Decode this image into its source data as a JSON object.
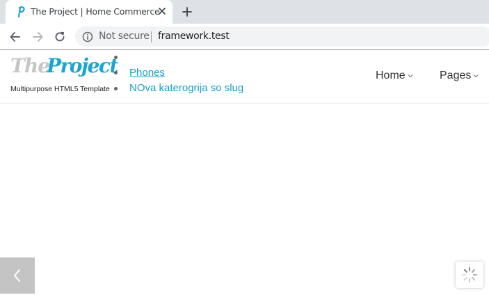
{
  "browser": {
    "tab": {
      "title": "The Project | Home Commerce",
      "favicon": "project-p-icon"
    },
    "toolbar": {
      "security_label": "Not secure",
      "url": "framework.test"
    }
  },
  "site": {
    "logo": {
      "the": "The",
      "project": "Project",
      "tagline": "Multipurpose HTML5 Template"
    },
    "breadcrumb": {
      "link": "Phones",
      "current": "NOva katerogrija so slug"
    },
    "menu": [
      {
        "label": "Home"
      },
      {
        "label": "Pages"
      }
    ],
    "colors": {
      "accent": "#1da5d2",
      "logo_gray": "#c6c6c6",
      "slider_arrow_bg": "#c4c4c4"
    }
  },
  "icons": [
    "project-p-icon",
    "close-icon",
    "plus-icon",
    "back-arrow-icon",
    "forward-arrow-icon",
    "reload-icon",
    "info-icon",
    "chevron-down-icon",
    "chevron-left-icon",
    "spinner-icon"
  ]
}
